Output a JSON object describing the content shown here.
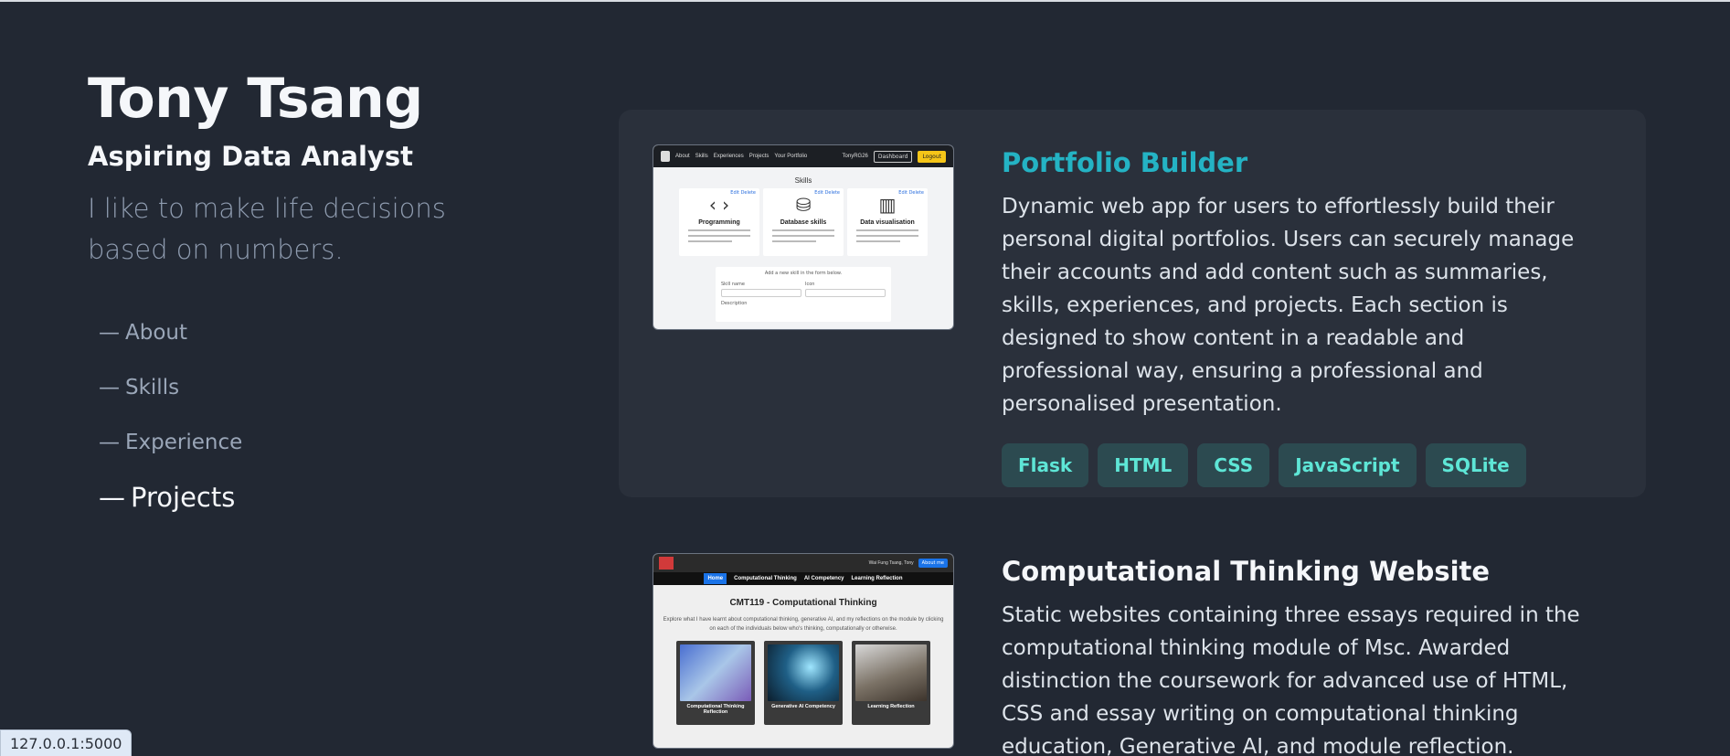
{
  "profile": {
    "name": "Tony Tsang",
    "role": "Aspiring Data Analyst",
    "tagline": "I like to make life decisions based on numbers."
  },
  "nav": {
    "dash": "—",
    "items": [
      {
        "label": "About"
      },
      {
        "label": "Skills"
      },
      {
        "label": "Experience"
      },
      {
        "label": "Projects"
      }
    ],
    "active": "Projects"
  },
  "projects": [
    {
      "title": "Portfolio Builder",
      "description": "Dynamic web app for users to effortlessly build their personal digital portfolios. Users can securely manage their accounts and add content such as summaries, skills, experiences, and projects. Each section is designed to show content in a readable and professional way, ensuring a professional and personalised presentation.",
      "tags": [
        "Flask",
        "HTML",
        "CSS",
        "JavaScript",
        "SQLite"
      ],
      "thumbnail": {
        "nav_links": [
          "About",
          "Skills",
          "Experiences",
          "Projects",
          "Your Portfolio"
        ],
        "user": "TonyRG26",
        "buttons": [
          "Dashboard",
          "Logout"
        ],
        "heading": "Skills",
        "cards": [
          {
            "icon": "‹ ›",
            "title": "Programming",
            "edit": "Edit  Delete"
          },
          {
            "icon": "⛁",
            "title": "Database skills",
            "edit": "Edit  Delete"
          },
          {
            "icon": "▥",
            "title": "Data visualisation",
            "edit": "Edit  Delete"
          }
        ],
        "form_title": "Add a new skill in the form below.",
        "form_labels": [
          "Skill name",
          "Icon",
          "Description"
        ]
      }
    },
    {
      "title": "Computational Thinking Website",
      "description": "Static websites containing three essays required in the computational thinking module of Msc. Awarded distinction the coursework for advanced use of HTML, CSS and essay writing on computational thinking education, Generative AI, and module reflection.",
      "thumbnail": {
        "user": "Wai Fung Tsang, Tony",
        "button": "About me",
        "tabs": [
          "Home",
          "Computational Thinking",
          "AI Competency",
          "Learning Reflection"
        ],
        "heading": "CMT119 - Computational Thinking",
        "intro": "Explore what I have learnt about computational thinking, generative AI, and my reflections on the module by clicking on each of the individuals below who's thinking, computationally or otherwise.",
        "cards": [
          "Computational Thinking Reflection",
          "Generative AI Competency",
          "Learning Reflection"
        ]
      }
    }
  ],
  "status_bar": "127.0.0.1:5000",
  "colors": {
    "background": "#222833",
    "card": "#2a303b",
    "accent_title": "#24b3c4",
    "tag_text": "#5ee6d6",
    "tag_bg": "#2c4a50"
  }
}
